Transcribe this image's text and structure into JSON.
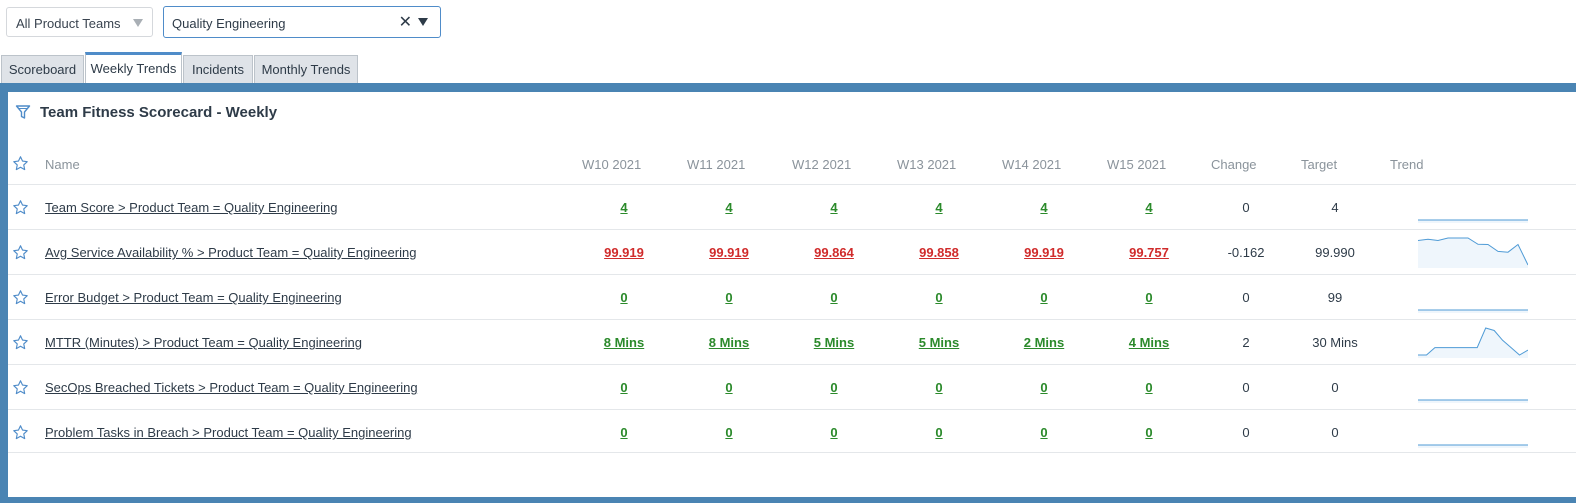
{
  "filters": {
    "team_group": "All Product Teams",
    "team": "Quality Engineering"
  },
  "tabs": [
    "Scoreboard",
    "Weekly Trends",
    "Incidents",
    "Monthly Trends"
  ],
  "active_tab": "Weekly Trends",
  "scorecard": {
    "title": "Team Fitness Scorecard - Weekly",
    "columns": {
      "name": "Name",
      "weeks": [
        "W10 2021",
        "W11 2021",
        "W12 2021",
        "W13 2021",
        "W14 2021",
        "W15 2021"
      ],
      "change": "Change",
      "target": "Target",
      "trend": "Trend"
    },
    "rows": [
      {
        "name": "Team Score > Product Team = Quality Engineering",
        "values": [
          "4",
          "4",
          "4",
          "4",
          "4",
          "4"
        ],
        "status": "good",
        "change": "0",
        "target": "4",
        "trend": [
          4,
          4,
          4,
          4,
          4,
          4
        ]
      },
      {
        "name": "Avg Service Availability % > Product Team = Quality Engineering",
        "values": [
          "99.919",
          "99.919",
          "99.864",
          "99.858",
          "99.919",
          "99.757"
        ],
        "status": "bad",
        "change": "-0.162",
        "target": "99.990",
        "trend": [
          99.95,
          99.96,
          99.95,
          99.97,
          99.97,
          99.97,
          99.92,
          99.919,
          99.864,
          99.858,
          99.919,
          99.757
        ]
      },
      {
        "name": "Error Budget > Product Team = Quality Engineering",
        "values": [
          "0",
          "0",
          "0",
          "0",
          "0",
          "0"
        ],
        "status": "good",
        "change": "0",
        "target": "99",
        "trend": [
          0,
          0,
          0,
          0,
          0,
          0
        ]
      },
      {
        "name": "MTTR (Minutes) > Product Team = Quality Engineering",
        "values": [
          "8 Mins",
          "8 Mins",
          "5 Mins",
          "5 Mins",
          "2 Mins",
          "4 Mins"
        ],
        "status": "good",
        "change": "2",
        "target": "30 Mins",
        "trend": [
          2,
          2,
          5,
          5,
          5,
          5,
          5,
          5,
          13,
          12,
          8,
          5,
          2,
          4
        ]
      },
      {
        "name": "SecOps Breached Tickets > Product Team = Quality Engineering",
        "values": [
          "0",
          "0",
          "0",
          "0",
          "0",
          "0"
        ],
        "status": "good",
        "change": "0",
        "target": "0",
        "trend": [
          0,
          0,
          0,
          0,
          0,
          0
        ]
      },
      {
        "name": "Problem Tasks in Breach > Product Team = Quality Engineering",
        "values": [
          "0",
          "0",
          "0",
          "0",
          "0",
          "0"
        ],
        "status": "good",
        "change": "0",
        "target": "0",
        "trend": [
          0,
          0,
          0,
          0,
          0,
          0
        ]
      }
    ]
  },
  "colors": {
    "accent": "#4f8cc9",
    "frame": "#4a84b3",
    "good": "#2b8a2b",
    "bad": "#d02b2b",
    "sparkline": "#4f9bd6"
  },
  "icons": {
    "filter": "filter-icon",
    "favorite": "star-outline-icon",
    "clear": "close-icon",
    "dropdown": "caret-down-icon"
  }
}
